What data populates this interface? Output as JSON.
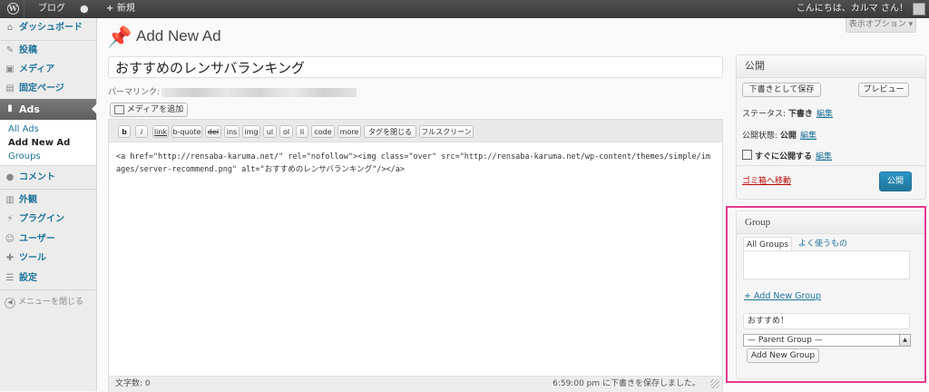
{
  "admin_bar": {
    "site_name": "ブログ",
    "new_label": "新規",
    "greeting": "こんにちは、カルマ さん！"
  },
  "screen_options": "表示オプション ▾",
  "sidebar": {
    "items": [
      {
        "icon": "home-icon",
        "glyph": "⌂",
        "label": "ダッシュボード"
      },
      {
        "icon": "pin-icon",
        "glyph": "✎",
        "label": "投稿"
      },
      {
        "icon": "media-icon",
        "glyph": "▣",
        "label": "メディア"
      },
      {
        "icon": "page-icon",
        "glyph": "▤",
        "label": "固定ページ"
      },
      {
        "icon": "ads-icon",
        "glyph": "▮",
        "label": "Ads"
      },
      {
        "icon": "comment-icon",
        "glyph": "●",
        "label": "コメント"
      },
      {
        "icon": "appearance-icon",
        "glyph": "▥",
        "label": "外観"
      },
      {
        "icon": "plugin-icon",
        "glyph": "⚡",
        "label": "プラグイン"
      },
      {
        "icon": "users-icon",
        "glyph": "☺",
        "label": "ユーザー"
      },
      {
        "icon": "tools-icon",
        "glyph": "✚",
        "label": "ツール"
      },
      {
        "icon": "settings-icon",
        "glyph": "☰",
        "label": "設定"
      }
    ],
    "submenu": [
      "All Ads",
      "Add New Ad",
      "Groups"
    ],
    "collapse_label": "メニューを閉じる"
  },
  "page": {
    "title": "Add New Ad",
    "post_title": "おすすめのレンサバランキング",
    "permalink_label": "パーマリンク:",
    "add_media": "メディアを追加",
    "quicktags": [
      "b",
      "i",
      "link",
      "b-quote",
      "del",
      "ins",
      "img",
      "ul",
      "ol",
      "li",
      "code",
      "more",
      "タグを閉じる",
      "フルスクリーン"
    ],
    "content": "<a href=\"http://rensaba-karuma.net/\" rel=\"nofollow\"><img class=\"over\" src=\"http://rensaba-karuma.net/wp-content/themes/simple/images/server-recommend.png\" alt=\"おすすめのレンサバランキング\"/></a>",
    "word_count": "文字数: 0",
    "autosave": "6:59:00 pm に下書きを保存しました。"
  },
  "publish": {
    "title": "公開",
    "save_draft": "下書きとして保存",
    "preview": "プレビュー",
    "status_label": "ステータス:",
    "status_value": "下書き",
    "visibility_label": "公開状態:",
    "visibility_value": "公開",
    "schedule_label": "すぐに公開する",
    "edit": "編集",
    "trash": "ゴミ箱へ移動",
    "publish_button": "公開"
  },
  "group_box": {
    "title": "Group",
    "tabs": [
      "All Groups",
      "よく使うもの"
    ],
    "add_new_link": "+ Add New Group",
    "new_group_value": "おすすめ！",
    "parent_select": "— Parent Group —",
    "add_button": "Add New Group",
    "highlight_color": "#e33b8e"
  }
}
